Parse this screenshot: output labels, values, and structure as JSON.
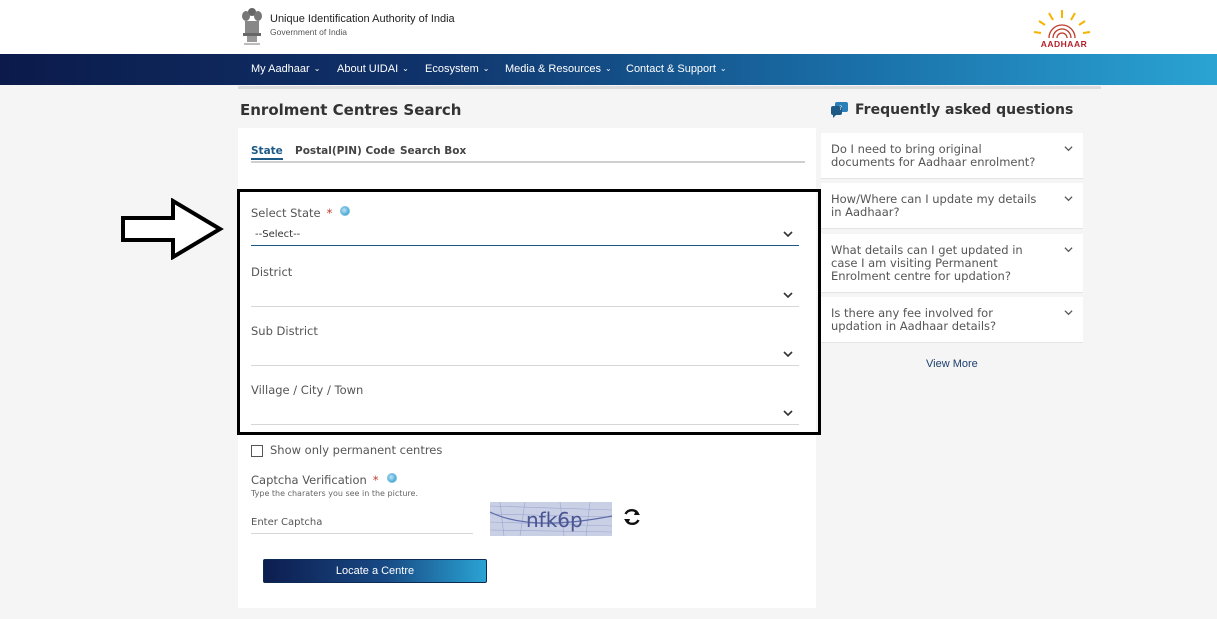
{
  "header": {
    "org_name": "Unique Identification Authority of India",
    "org_sub": "Government of India",
    "logo_text": "AADHAAR"
  },
  "nav": {
    "items": [
      {
        "label": "My Aadhaar"
      },
      {
        "label": "About UIDAI"
      },
      {
        "label": "Ecosystem"
      },
      {
        "label": "Media & Resources"
      },
      {
        "label": "Contact & Support"
      }
    ]
  },
  "search": {
    "title": "Enrolment Centres Search",
    "tabs": [
      {
        "label": "State",
        "active": true
      },
      {
        "label": "Postal(PIN) Code",
        "active": false
      },
      {
        "label": "Search Box",
        "active": false
      }
    ],
    "fields": {
      "state": {
        "label": "Select State",
        "required": "*",
        "value": "--Select--"
      },
      "district": {
        "label": "District",
        "value": ""
      },
      "sub_district": {
        "label": "Sub District",
        "value": ""
      },
      "village": {
        "label": "Village / City / Town",
        "value": ""
      }
    },
    "permanent_only_label": "Show only permanent centres",
    "permanent_only_checked": false,
    "captcha": {
      "label": "Captcha Verification",
      "required": "*",
      "hint": "Type the charaters you see in the picture.",
      "placeholder": "Enter Captcha",
      "image_text": "nfk6p"
    },
    "submit_label": "Locate a Centre"
  },
  "faq": {
    "title": "Frequently asked questions",
    "items": [
      {
        "q": "Do I need to bring original documents for Aadhaar enrolment?"
      },
      {
        "q": "How/Where can I update my details in Aadhaar?"
      },
      {
        "q": "What details can I get updated in case I am visiting Permanent Enrolment centre for updation?"
      },
      {
        "q": "Is there any fee involved for updation in Aadhaar details?"
      }
    ],
    "view_more": "View More"
  },
  "colors": {
    "nav_start": "#0b1a4a",
    "nav_end": "#2aa3d3",
    "accent": "#1d5a86",
    "required": "#c0392b"
  },
  "icons": [
    "emblem-icon",
    "aadhaar-logo-icon",
    "chevron-down-icon",
    "info-icon",
    "refresh-icon",
    "faq-chat-icon",
    "arrow-right-icon"
  ]
}
